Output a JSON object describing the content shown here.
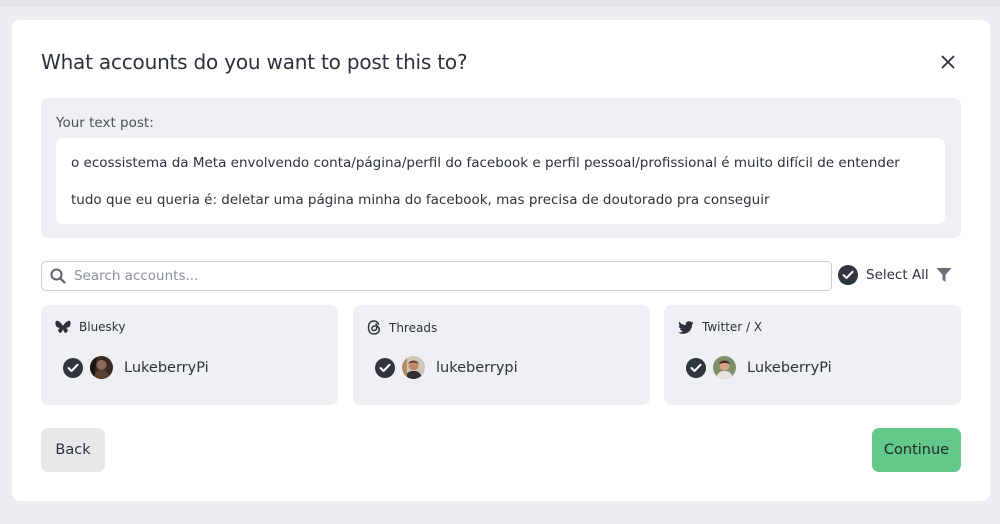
{
  "dialog": {
    "title": "What accounts do you want to post this to?",
    "close_icon": "close-icon"
  },
  "post": {
    "label": "Your text post:",
    "lines": [
      "o ecossistema da Meta envolvendo conta/página/perfil do facebook  e perfil pessoal/profissional é muito difícil de entender",
      "tudo que eu queria é: deletar uma página minha do facebook, mas precisa de doutorado pra conseguir"
    ]
  },
  "search": {
    "placeholder": "Search accounts...",
    "value": "",
    "icon": "search-icon"
  },
  "select_all": {
    "label": "Select All",
    "checked": true
  },
  "filter_icon": "filter-icon",
  "platforms": [
    {
      "name": "Bluesky",
      "icon": "butterfly-icon",
      "accounts": [
        {
          "handle": "LukeberryPi",
          "checked": true
        }
      ]
    },
    {
      "name": "Threads",
      "icon": "threads-icon",
      "accounts": [
        {
          "handle": "lukeberrypi",
          "checked": true
        }
      ]
    },
    {
      "name": "Twitter / X",
      "icon": "twitter-bird-icon",
      "accounts": [
        {
          "handle": "LukeberryPi",
          "checked": true
        }
      ]
    }
  ],
  "actions": {
    "back_label": "Back",
    "continue_label": "Continue"
  },
  "colors": {
    "accent": "#63c98a",
    "check": "#2f3640",
    "panel": "#eef0f3",
    "page_bg": "#eceef1"
  }
}
